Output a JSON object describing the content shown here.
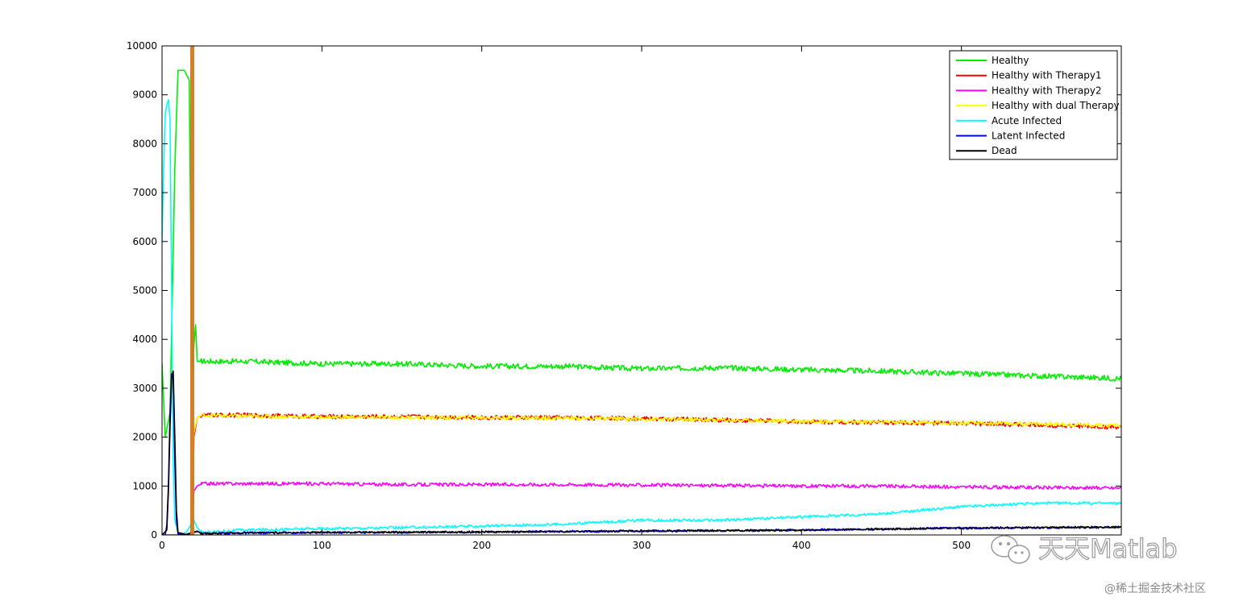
{
  "chart_data": {
    "type": "line",
    "title": "",
    "xlabel": "",
    "ylabel": "",
    "xlim": [
      0,
      600
    ],
    "ylim": [
      0,
      10000
    ],
    "x_ticks": [
      0,
      100,
      200,
      300,
      400,
      500
    ],
    "x_tick_labels": [
      "0",
      "100",
      "200",
      "300",
      "400",
      "500"
    ],
    "y_ticks": [
      0,
      1000,
      2000,
      3000,
      4000,
      5000,
      6000,
      7000,
      8000,
      9000,
      10000
    ],
    "y_tick_labels": [
      "0",
      "1000",
      "2000",
      "3000",
      "4000",
      "5000",
      "6000",
      "7000",
      "8000",
      "9000",
      "10000"
    ],
    "grid": false,
    "legend_position": "top-right",
    "series": [
      {
        "name": "Healthy",
        "color": "#00ee00",
        "x": [
          0,
          2,
          5,
          8,
          10,
          14,
          17,
          18,
          19,
          20,
          21,
          22,
          25,
          50,
          100,
          150,
          200,
          250,
          300,
          350,
          400,
          450,
          500,
          550,
          600
        ],
        "y": [
          3500,
          2000,
          2500,
          7500,
          9500,
          9500,
          9300,
          6000,
          3300,
          3900,
          4300,
          3550,
          3550,
          3550,
          3500,
          3500,
          3450,
          3450,
          3400,
          3420,
          3380,
          3350,
          3300,
          3250,
          3200
        ]
      },
      {
        "name": "Healthy with Therapy1",
        "color": "#ff0000",
        "x": [
          0,
          18,
          19,
          20,
          22,
          25,
          50,
          100,
          150,
          200,
          250,
          300,
          350,
          400,
          450,
          500,
          550,
          600
        ],
        "y": [
          0,
          0,
          800,
          2000,
          2400,
          2450,
          2450,
          2420,
          2420,
          2400,
          2400,
          2380,
          2350,
          2320,
          2300,
          2280,
          2250,
          2200
        ]
      },
      {
        "name": "Healthy with Therapy2",
        "color": "#ff00ff",
        "x": [
          0,
          18,
          19,
          20,
          22,
          25,
          50,
          100,
          150,
          200,
          250,
          300,
          350,
          400,
          450,
          500,
          550,
          600
        ],
        "y": [
          0,
          0,
          600,
          900,
          1000,
          1050,
          1050,
          1050,
          1030,
          1030,
          1030,
          1020,
          1010,
          1000,
          1000,
          980,
          970,
          960
        ]
      },
      {
        "name": "Healthy with dual Therapy",
        "color": "#ffff00",
        "x": [
          0,
          18,
          19,
          20,
          22,
          25,
          50,
          100,
          150,
          200,
          250,
          300,
          350,
          400,
          450,
          500,
          550,
          600
        ],
        "y": [
          0,
          0,
          1000,
          2100,
          2400,
          2450,
          2430,
          2410,
          2400,
          2400,
          2390,
          2370,
          2350,
          2330,
          2310,
          2290,
          2270,
          2240
        ]
      },
      {
        "name": "Acute Infected",
        "color": "#00ffff",
        "x": [
          0,
          1,
          2,
          3,
          4,
          5,
          6,
          7,
          8,
          10,
          12,
          15,
          18,
          20,
          22,
          25,
          50,
          100,
          150,
          200,
          250,
          300,
          350,
          400,
          450,
          500,
          550,
          600
        ],
        "y": [
          6000,
          7500,
          8600,
          8800,
          8900,
          8500,
          5000,
          1500,
          300,
          50,
          20,
          50,
          200,
          300,
          150,
          50,
          100,
          130,
          150,
          180,
          220,
          300,
          300,
          370,
          430,
          580,
          650,
          650
        ]
      },
      {
        "name": "Latent Infected",
        "color": "#0000ff",
        "x": [
          0,
          2,
          3,
          4,
          5,
          6,
          7,
          8,
          9,
          10,
          15,
          20,
          22,
          25,
          50,
          100,
          200,
          300,
          400,
          500,
          600
        ],
        "y": [
          0,
          0,
          200,
          1000,
          2500,
          3300,
          3200,
          1500,
          300,
          20,
          10,
          60,
          80,
          30,
          40,
          50,
          60,
          80,
          100,
          140,
          160
        ]
      },
      {
        "name": "Dead",
        "color": "#000000",
        "x": [
          0,
          3,
          4,
          5,
          6,
          7,
          8,
          9,
          10,
          15,
          20,
          22,
          25,
          50,
          100,
          200,
          300,
          400,
          500,
          600
        ],
        "y": [
          0,
          100,
          900,
          2200,
          3200,
          3350,
          2000,
          500,
          50,
          10,
          50,
          70,
          30,
          40,
          50,
          60,
          80,
          100,
          140,
          160
        ]
      }
    ]
  },
  "watermark": {
    "brand": "天天Matlab",
    "site": "@稀土掘金技术社区"
  }
}
